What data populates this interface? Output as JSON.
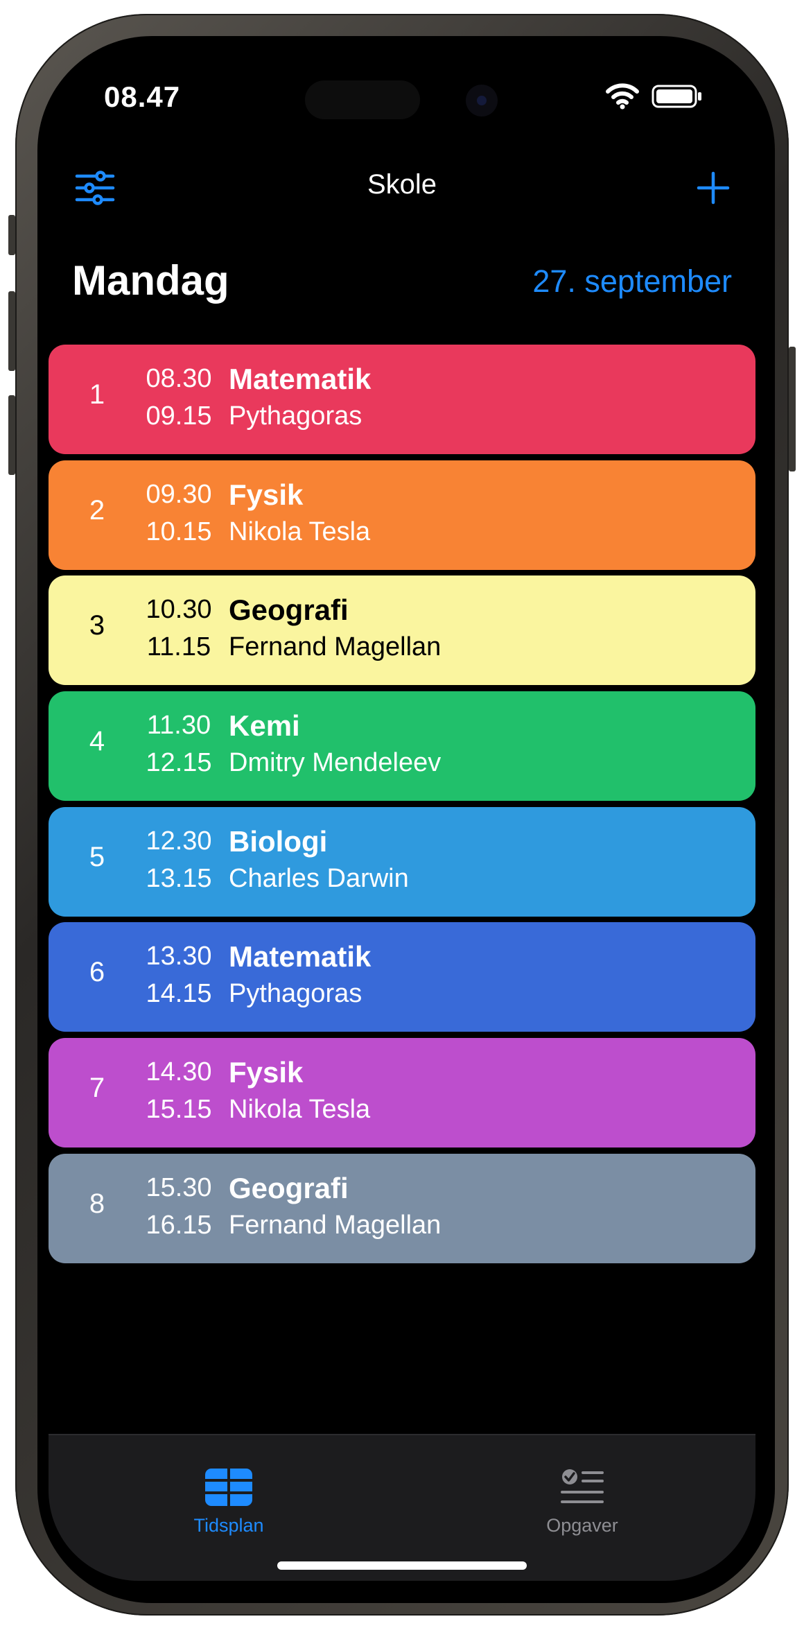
{
  "status_bar": {
    "time": "08.47",
    "wifi_icon": "wifi-icon",
    "battery_icon": "battery-icon"
  },
  "nav": {
    "title": "Skole",
    "left_icon": "filter-sliders-icon",
    "right_icon": "plus-icon",
    "accent_color": "#1e8bff"
  },
  "day": {
    "name": "Mandag",
    "date": "27. september"
  },
  "lessons": [
    {
      "number": "1",
      "start": "08.30",
      "end": "09.15",
      "subject": "Matematik",
      "teacher": "Pythagoras",
      "color": "#e9395c"
    },
    {
      "number": "2",
      "start": "09.30",
      "end": "10.15",
      "subject": "Fysik",
      "teacher": "Nikola Tesla",
      "color": "#f88334"
    },
    {
      "number": "3",
      "start": "10.30",
      "end": "11.15",
      "subject": "Geografi",
      "teacher": "Fernand Magellan",
      "color": "#faf59f"
    },
    {
      "number": "4",
      "start": "11.30",
      "end": "12.15",
      "subject": "Kemi",
      "teacher": "Dmitry Mendeleev",
      "color": "#21c06b"
    },
    {
      "number": "5",
      "start": "12.30",
      "end": "13.15",
      "subject": "Biologi",
      "teacher": "Charles Darwin",
      "color": "#2f9ade"
    },
    {
      "number": "6",
      "start": "13.30",
      "end": "14.15",
      "subject": "Matematik",
      "teacher": "Pythagoras",
      "color": "#396ad8"
    },
    {
      "number": "7",
      "start": "14.30",
      "end": "15.15",
      "subject": "Fysik",
      "teacher": "Nikola Tesla",
      "color": "#bd4ecd"
    },
    {
      "number": "8",
      "start": "15.30",
      "end": "16.15",
      "subject": "Geografi",
      "teacher": "Fernand Magellan",
      "color": "#7b8ea4"
    }
  ],
  "tabs": [
    {
      "label": "Tidsplan",
      "icon": "grid-schedule-icon",
      "selected": true
    },
    {
      "label": "Opgaver",
      "icon": "task-checklist-icon",
      "selected": false
    }
  ]
}
